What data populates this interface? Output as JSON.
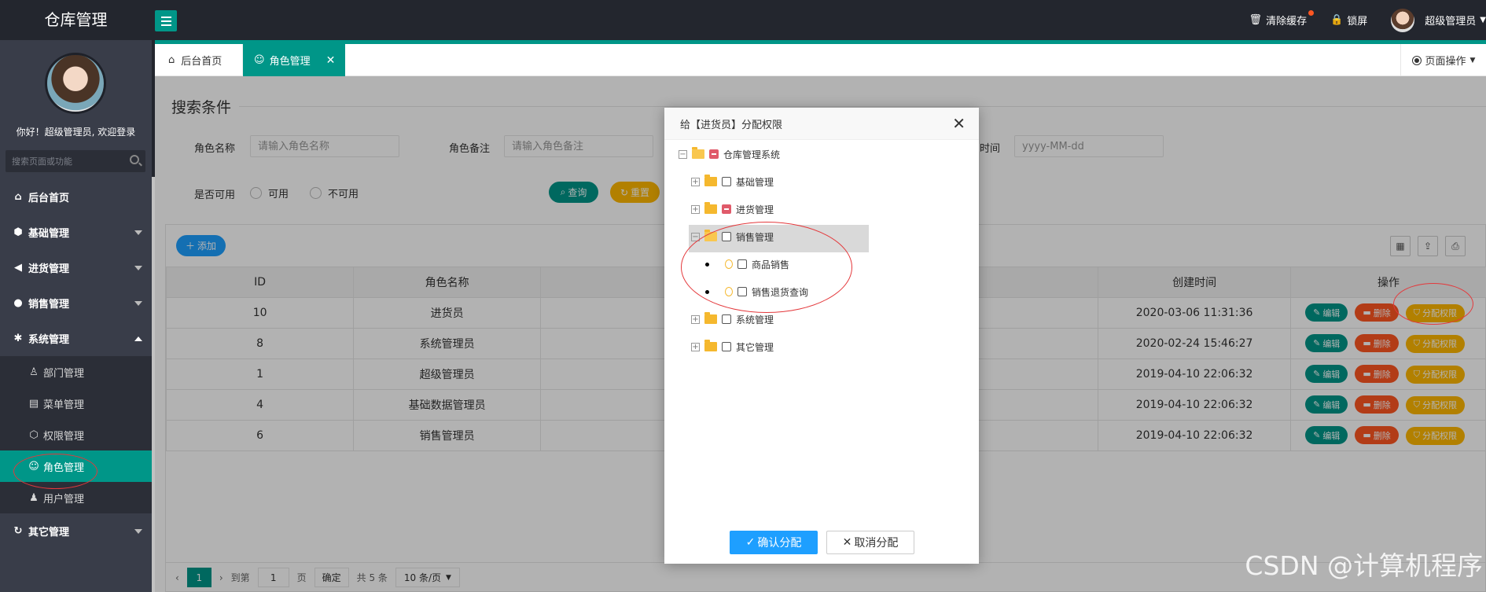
{
  "app": {
    "title": "仓库管理"
  },
  "topbar": {
    "clear_cache": "清除缓存",
    "lock_screen": "锁屏",
    "user_name": "超级管理员"
  },
  "sidebar": {
    "welcome": "你好！超级管理员, 欢迎登录",
    "search_placeholder": "搜索页面或功能",
    "items": [
      {
        "label": "后台首页",
        "icon": "home-icon"
      },
      {
        "label": "基础管理",
        "icon": "cube-icon"
      },
      {
        "label": "进货管理",
        "icon": "volume-icon"
      },
      {
        "label": "销售管理",
        "icon": "chat-icon"
      },
      {
        "label": "系统管理",
        "icon": "gear-icon"
      },
      {
        "label": "其它管理",
        "icon": "refresh-icon"
      }
    ],
    "sub_items": [
      {
        "label": "部门管理",
        "icon": "user-outline-icon"
      },
      {
        "label": "菜单管理",
        "icon": "menu-icon"
      },
      {
        "label": "权限管理",
        "icon": "cube-icon"
      },
      {
        "label": "角色管理",
        "icon": "smile-icon"
      },
      {
        "label": "用户管理",
        "icon": "user-icon"
      }
    ]
  },
  "tabs": [
    {
      "label": "后台首页"
    },
    {
      "label": "角色管理"
    }
  ],
  "page_ops": "页面操作",
  "search": {
    "legend": "搜索条件",
    "role_name_label": "角色名称",
    "role_name_placeholder": "请输入角色名称",
    "role_remark_label": "角色备注",
    "role_remark_placeholder": "请输入角色备注",
    "time_label": "时间",
    "time_placeholder": "yyyy-MM-dd",
    "available_label": "是否可用",
    "available_yes": "可用",
    "available_no": "不可用",
    "query_btn": "查询",
    "reset_btn": "重置",
    "add_btn": "添加"
  },
  "table": {
    "headers": [
      "ID",
      "角色名称",
      "创建时间",
      "操作"
    ],
    "rows": [
      {
        "id": "10",
        "name": "进货员",
        "created": "2020-03-06 11:31:36"
      },
      {
        "id": "8",
        "name": "系统管理员",
        "created": "2020-02-24 15:46:27"
      },
      {
        "id": "1",
        "name": "超级管理员",
        "created": "2019-04-10 22:06:32"
      },
      {
        "id": "4",
        "name": "基础数据管理员",
        "created": "2019-04-10 22:06:32"
      },
      {
        "id": "6",
        "name": "销售管理员",
        "created": "2019-04-10 22:06:32"
      }
    ],
    "op_edit": "编辑",
    "op_delete": "删除",
    "op_perm": "分配权限"
  },
  "pager": {
    "current": "1",
    "goto": "到第",
    "page_input": "1",
    "page_unit": "页",
    "confirm": "确定",
    "total": "共 5 条",
    "size": "10 条/页"
  },
  "modal": {
    "title": "给【进货员】分配权限",
    "tree": {
      "root": "仓库管理系统",
      "basic": "基础管理",
      "purchase": "进货管理",
      "sales": "销售管理",
      "sales_goods": "商品销售",
      "sales_return": "销售退货查询",
      "system": "系统管理",
      "other": "其它管理"
    },
    "confirm": "确认分配",
    "cancel": "取消分配"
  },
  "watermark": "CSDN @计算机程序",
  "colors": {
    "primary": "#009688",
    "danger": "#ff5722",
    "warm": "#ffb800",
    "blue": "#1e9fff"
  }
}
